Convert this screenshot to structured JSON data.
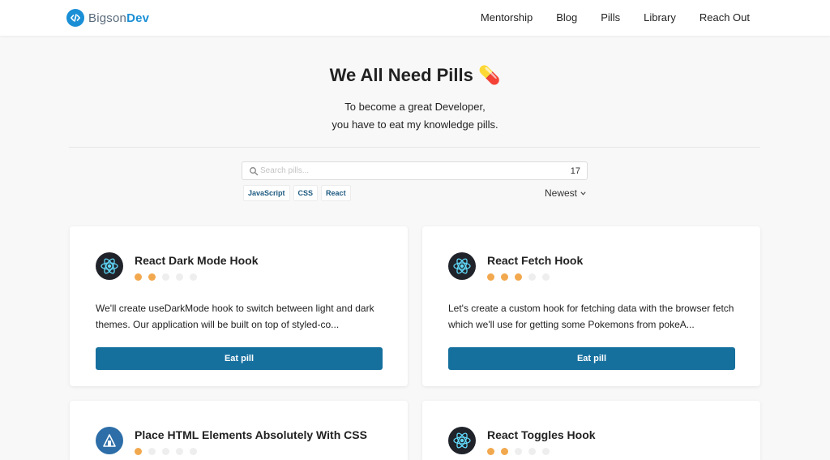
{
  "nav": {
    "logo_part1": "Bigson",
    "logo_part2": "Dev",
    "links": [
      "Mentorship",
      "Blog",
      "Pills",
      "Library",
      "Reach Out"
    ]
  },
  "hero": {
    "title": "We All Need Pills 💊",
    "subtitle_line1": "To become a great Developer,",
    "subtitle_line2": "you have to eat my knowledge pills."
  },
  "search": {
    "placeholder": "Search pills...",
    "value": "",
    "count": "17"
  },
  "tags": [
    "JavaScript",
    "CSS",
    "React"
  ],
  "sort": {
    "label": "Newest"
  },
  "colors": {
    "accent": "#16709e",
    "rating_on": "#f2a84e",
    "rating_off": "#eeeeee",
    "logo": "#1a8fd6"
  },
  "cards": [
    {
      "title": "React Dark Mode Hook",
      "icon": "react-icon",
      "rating": 2,
      "rating_max": 5,
      "description": "We'll create useDarkMode hook to switch between light and dark themes. Our application will be built on top of styled-co...",
      "button": "Eat pill"
    },
    {
      "title": "React Fetch Hook",
      "icon": "react-icon",
      "rating": 3,
      "rating_max": 5,
      "description": "Let's create a custom hook for fetching data with the browser fetch which we'll use for getting some Pokemons from pokeA...",
      "button": "Eat pill"
    },
    {
      "title": "Place HTML Elements Absolutely With CSS",
      "icon": "css-position-icon",
      "rating": 1,
      "rating_max": 5
    },
    {
      "title": "React Toggles Hook",
      "icon": "react-icon",
      "rating": 2,
      "rating_max": 5
    }
  ]
}
